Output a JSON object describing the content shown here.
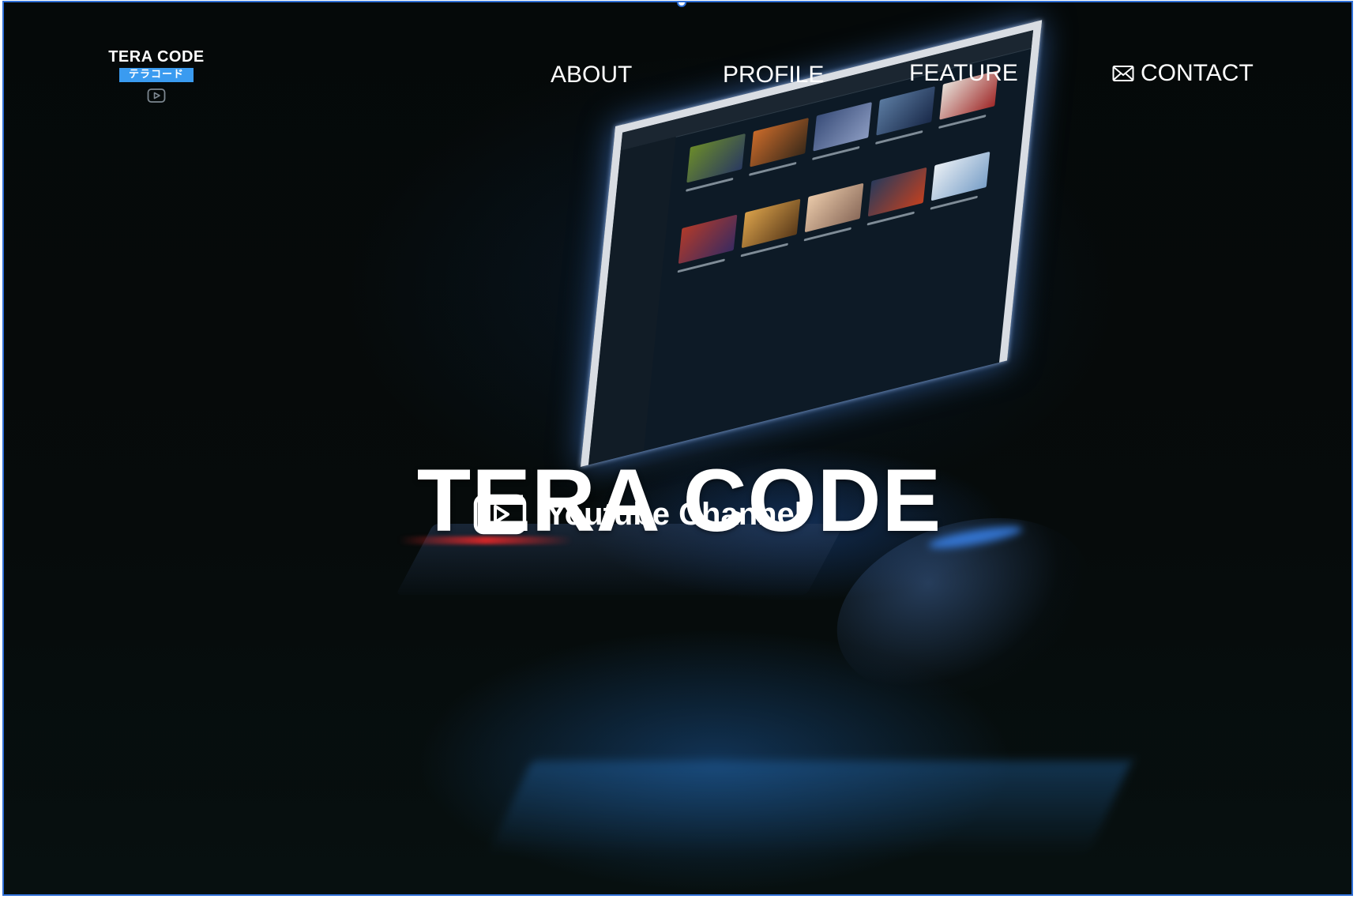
{
  "header": {
    "logo": {
      "title": "TERA CODE",
      "subtitle": "テラコード",
      "icon": "youtube-play-icon"
    },
    "nav": [
      {
        "label": "ABOUT"
      },
      {
        "label": "PROFILE"
      },
      {
        "label": "FEATURE"
      },
      {
        "label": "CONTACT",
        "icon": "mail-icon"
      }
    ]
  },
  "hero": {
    "title": "TERA CODE",
    "subtitle": "Youtube Channel",
    "subtitle_icon": "youtube-play-icon",
    "background": "laptop-showing-youtube-photo"
  },
  "colors": {
    "background": "#050808",
    "text": "#ffffff",
    "logo_accent": "#3a9bf0",
    "selection_border": "#2f6fd6"
  }
}
